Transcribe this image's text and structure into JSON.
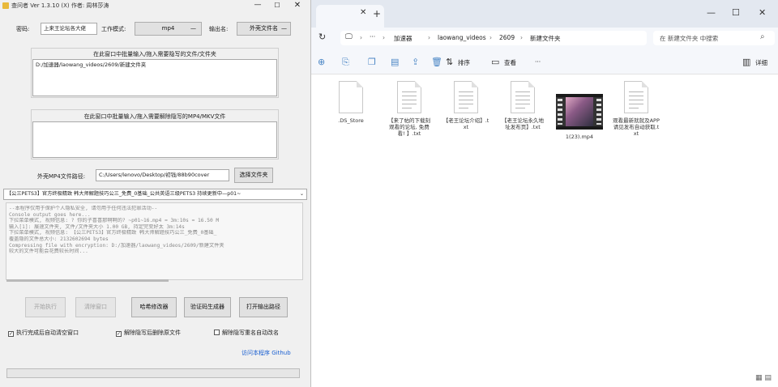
{
  "app": {
    "title": "查问者 Ver 1.3.10 (X) 作者: 周林莎涛",
    "window_controls": {
      "minimize": "—",
      "maximize": "☐",
      "close": "✕"
    },
    "password_label": "密码:",
    "password_value": "上来王论坛各大佬",
    "mode_label": "工作模式:",
    "mode_value": "mp4",
    "output_label": "输出名:",
    "output_value": "外壳文件名",
    "group1_title": "在此窗口中批量输入/拖入需要隐写的文件/文件夹",
    "group1_content": "D:/加速器/laowang_videos/2609/新建文件夹",
    "group2_title": "在此窗口中批量输入/拖入需要解除隐写的MP4/MKV文件",
    "group2_content": "",
    "shell_label": "外壳MP4文件路径:",
    "shell_value": "C:/Users/lenovo/Desktop/初钱/88b90cover",
    "shell_button": "选择文件夹",
    "dropdown_value": "【公三PETS3】官方终极精致 韩大师解题技巧公三_免费_0基础_公共英语三级PETS3 持续更新中—p01~",
    "console_lines": [
      "--本程序仅用于保护个人隐私安全, 请勿用于任何违法犯罪活动--",
      "Console output goes here...",
      "",
      "下拉菜单模式, 视频信息: ? 你的子喜喜那啊啊的? ~p01~16.mp4 = 3m:10s = 16.50 M",
      "输入[1]: 展速文件夹, 文件/文件夹大小 1.00 GB, 持定完变好太 3m:14s",
      "下拉菜单模式, 视频信息: 【公三PETS3】官方终极精致 韩大师解题技巧公三_免费_0基础_",
      "覆盖隐的文件总大小: 2132602694 bytes",
      "Compressing file with encryption: D:/加速器/laowang_videos/2609/新建文件夹",
      "较大的文件可能会花费较长时间..."
    ],
    "buttons": {
      "start": "开始执行",
      "clear": "清除窗口",
      "modifier": "哈希修改器",
      "verify": "验证码生成器",
      "open_output": "打开输出路径"
    },
    "checkboxes": [
      {
        "label": "执行完成后自动清空窗口",
        "checked": true
      },
      {
        "label": "解除隐写后删除原文件",
        "checked": true
      },
      {
        "label": "解除隐写重名自动改名",
        "checked": false
      }
    ],
    "github_link": "访问本程序 Github"
  },
  "explorer": {
    "tab_close": "✕",
    "new_tab": "+",
    "window_controls": {
      "minimize": "—",
      "maximize": "☐",
      "close": "✕"
    },
    "nav": {
      "refresh": "↻",
      "pc": "🖵",
      "chevron": "›",
      "more": "···"
    },
    "breadcrumb": [
      "加速器",
      "laowang_videos",
      "2609",
      "新建文件夹"
    ],
    "search_placeholder": "在 新建文件夹 中搜索",
    "toolbar": {
      "sort": "排序",
      "view": "查看",
      "more": "···",
      "details": "详细"
    },
    "files": [
      {
        "name": ".DS_Store",
        "type": "blank"
      },
      {
        "name": "【来了帖的下载刻观看的论坛, 免费看! 】.txt",
        "type": "text"
      },
      {
        "name": "【老王论坛介绍】.txt",
        "type": "text"
      },
      {
        "name": "【老王论坛永久地址发布页】.txt",
        "type": "text"
      },
      {
        "name": "1(23).mp4",
        "type": "video"
      },
      {
        "name": "观看最新就就及APP请见发布自动获取.txt",
        "type": "text"
      }
    ]
  }
}
